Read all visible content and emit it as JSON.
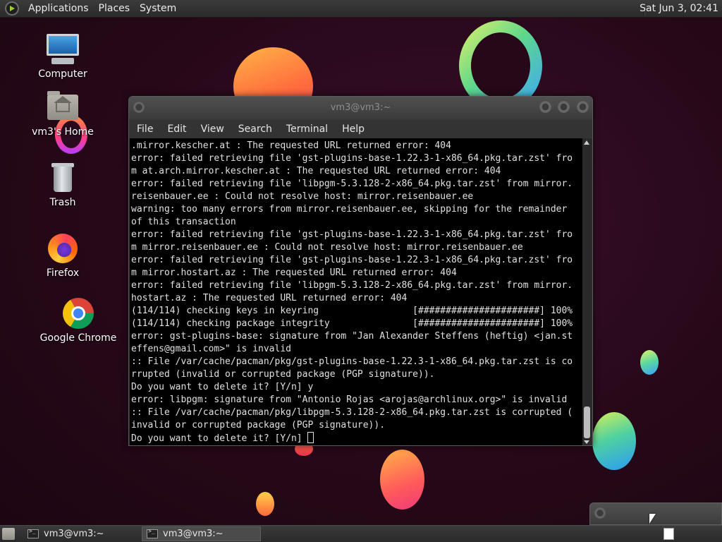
{
  "top_panel": {
    "menus": [
      "Applications",
      "Places",
      "System"
    ],
    "clock": "Sat Jun  3, 02:41"
  },
  "desktop_icons": [
    {
      "label": "Computer",
      "icon": "computer-icon"
    },
    {
      "label": "vm3's Home",
      "icon": "home-folder-icon"
    },
    {
      "label": "Trash",
      "icon": "trash-icon"
    },
    {
      "label": "Firefox",
      "icon": "firefox-icon"
    },
    {
      "label": "Google Chrome",
      "icon": "chrome-icon"
    }
  ],
  "terminal": {
    "title": "vm3@vm3:~",
    "menu": [
      "File",
      "Edit",
      "View",
      "Search",
      "Terminal",
      "Help"
    ],
    "lines": [
      ".mirror.kescher.at : The requested URL returned error: 404",
      "error: failed retrieving file 'gst-plugins-base-1.22.3-1-x86_64.pkg.tar.zst' fro",
      "m at.arch.mirror.kescher.at : The requested URL returned error: 404",
      "error: failed retrieving file 'libpgm-5.3.128-2-x86_64.pkg.tar.zst' from mirror.",
      "reisenbauer.ee : Could not resolve host: mirror.reisenbauer.ee",
      "warning: too many errors from mirror.reisenbauer.ee, skipping for the remainder",
      "of this transaction",
      "error: failed retrieving file 'gst-plugins-base-1.22.3-1-x86_64.pkg.tar.zst' fro",
      "m mirror.reisenbauer.ee : Could not resolve host: mirror.reisenbauer.ee",
      "error: failed retrieving file 'gst-plugins-base-1.22.3-1-x86_64.pkg.tar.zst' fro",
      "m mirror.hostart.az : The requested URL returned error: 404",
      "error: failed retrieving file 'libpgm-5.3.128-2-x86_64.pkg.tar.zst' from mirror.",
      "hostart.az : The requested URL returned error: 404",
      "(114/114) checking keys in keyring                 [######################] 100%",
      "(114/114) checking package integrity               [######################] 100%",
      "error: gst-plugins-base: signature from \"Jan Alexander Steffens (heftig) <jan.st",
      "effens@gmail.com>\" is invalid",
      ":: File /var/cache/pacman/pkg/gst-plugins-base-1.22.3-1-x86_64.pkg.tar.zst is co",
      "rrupted (invalid or corrupted package (PGP signature)).",
      "Do you want to delete it? [Y/n] y",
      "error: libpgm: signature from \"Antonio Rojas <arojas@archlinux.org>\" is invalid",
      ":: File /var/cache/pacman/pkg/libpgm-5.3.128-2-x86_64.pkg.tar.zst is corrupted (",
      "invalid or corrupted package (PGP signature))."
    ],
    "prompt_line": "Do you want to delete it? [Y/n] "
  },
  "taskbar": {
    "tasks": [
      {
        "label": "vm3@vm3:~",
        "active": false
      },
      {
        "label": "vm3@vm3:~",
        "active": true
      }
    ]
  }
}
